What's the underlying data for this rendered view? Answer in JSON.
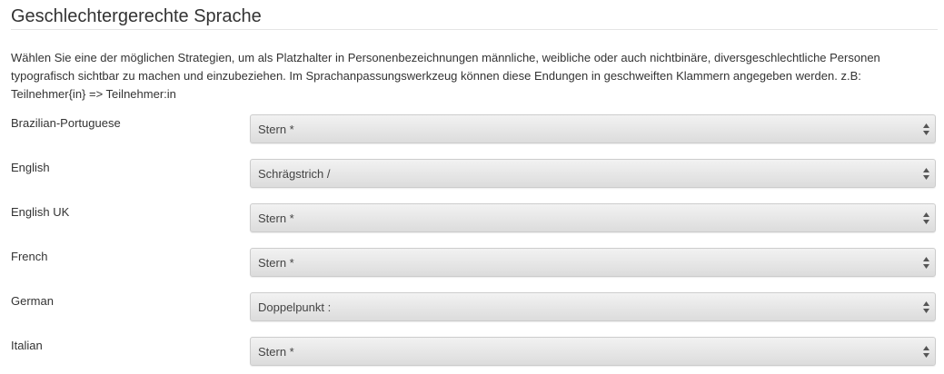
{
  "section": {
    "title": "Geschlechtergerechte Sprache",
    "description": "Wählen Sie eine der möglichen Strategien, um als Platzhalter in Personenbezeichnungen männliche, weibliche oder auch nichtbinäre, diversgeschlechtliche Personen typografisch sichtbar zu machen und einzubeziehen. Im Sprachanpassungswerkzeug können diese Endungen in geschweiften Klammern angegeben werden. z.B: Teilnehmer{in} => Teilnehmer:in"
  },
  "languages": [
    {
      "label": "Brazilian-Portuguese",
      "selected": "Stern *"
    },
    {
      "label": "English",
      "selected": "Schrägstrich /"
    },
    {
      "label": "English UK",
      "selected": "Stern *"
    },
    {
      "label": "French",
      "selected": "Stern *"
    },
    {
      "label": "German",
      "selected": "Doppelpunkt :"
    },
    {
      "label": "Italian",
      "selected": "Stern *"
    }
  ]
}
